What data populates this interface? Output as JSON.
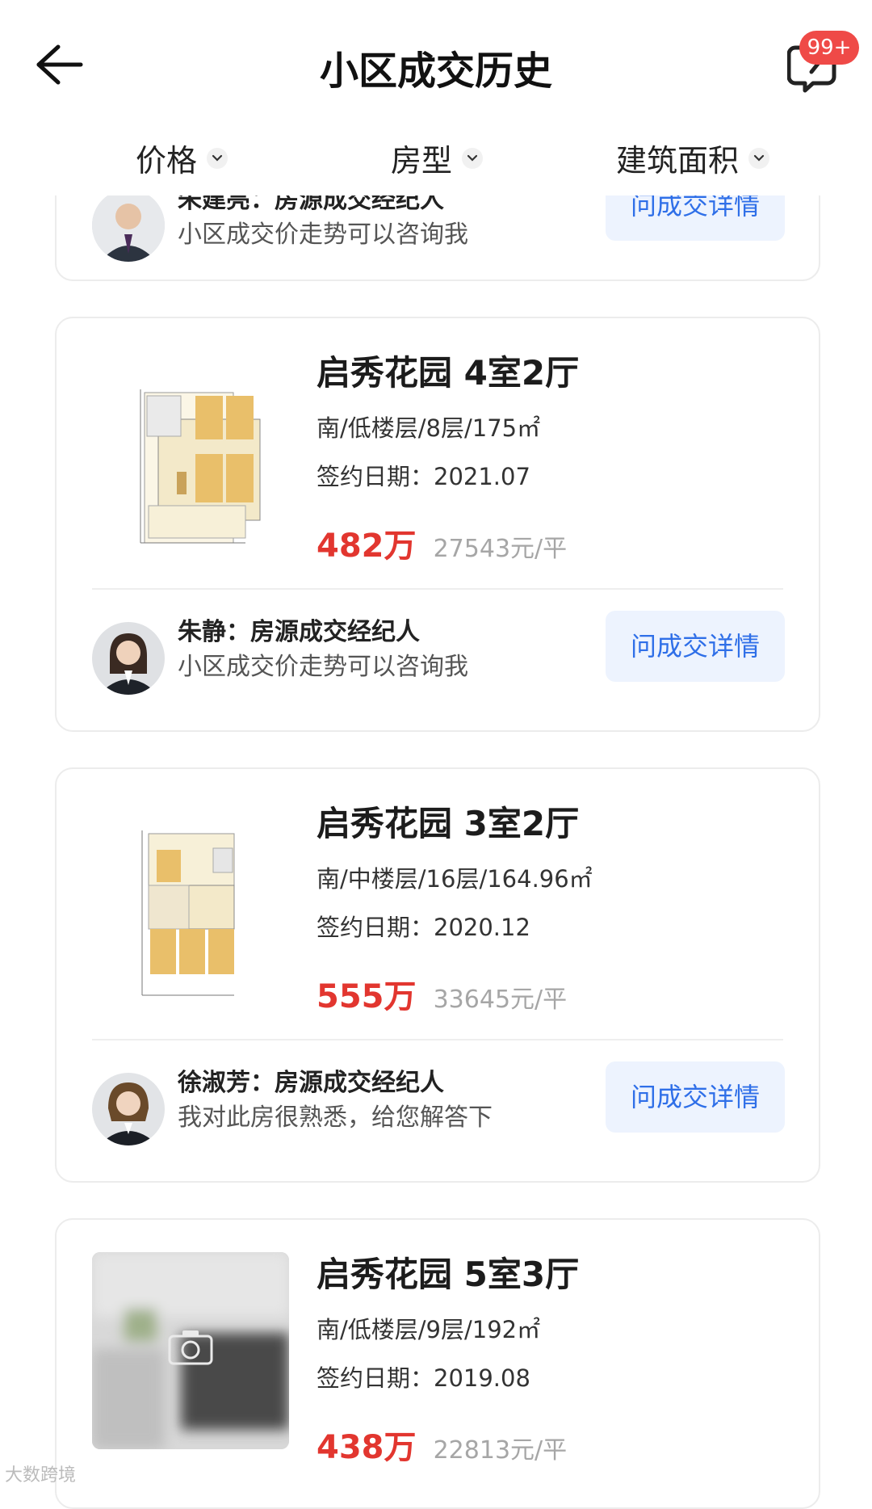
{
  "header": {
    "title": "小区成交历史",
    "badge": "99+"
  },
  "filters": [
    {
      "label": "价格"
    },
    {
      "label": "房型"
    },
    {
      "label": "建筑面积"
    }
  ],
  "partial_card": {
    "agent_title": "朱建亮：房源成交经纪人",
    "agent_sub": "小区成交价走势可以咨询我",
    "button": "问成交详情"
  },
  "cards": [
    {
      "name": "启秀花园 4室2厅",
      "meta": "南/低楼层/8层/175㎡",
      "date": "签约日期：2021.07",
      "price": "482万",
      "unit_price": "27543元/平",
      "agent_title": "朱静：房源成交经纪人",
      "agent_sub": "小区成交价走势可以咨询我",
      "button": "问成交详情"
    },
    {
      "name": "启秀花园 3室2厅",
      "meta": "南/中楼层/16层/164.96㎡",
      "date": "签约日期：2020.12",
      "price": "555万",
      "unit_price": "33645元/平",
      "agent_title": "徐淑芳：房源成交经纪人",
      "agent_sub": "我对此房很熟悉，给您解答下",
      "button": "问成交详情"
    },
    {
      "name": "启秀花园 5室3厅",
      "meta": "南/低楼层/9层/192㎡",
      "date": "签约日期：2019.08",
      "price": "438万",
      "unit_price": "22813元/平"
    }
  ],
  "watermark": "大数跨境",
  "colors": {
    "price": "#e2362f",
    "button_text": "#2f6fe8",
    "button_bg": "#edf3fe",
    "badge": "#ef4a47"
  }
}
